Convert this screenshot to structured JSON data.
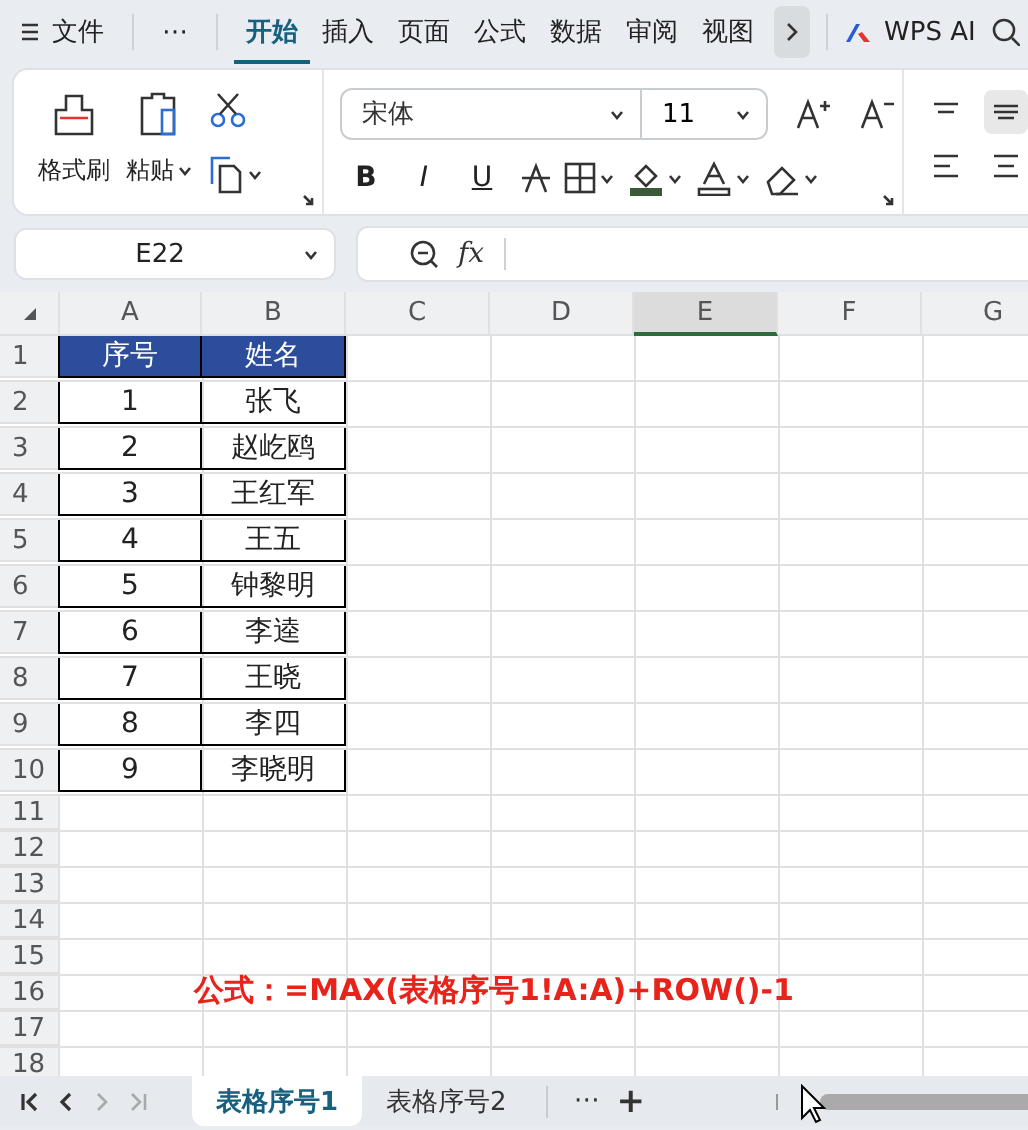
{
  "menu_bar": {
    "file": "文件",
    "more": "⋯",
    "tabs": [
      {
        "label": "开始",
        "selected": true
      },
      {
        "label": "插入",
        "selected": false
      },
      {
        "label": "页面",
        "selected": false
      },
      {
        "label": "公式",
        "selected": false
      },
      {
        "label": "数据",
        "selected": false
      },
      {
        "label": "审阅",
        "selected": false
      },
      {
        "label": "视图",
        "selected": false
      }
    ],
    "ai": "WPS AI"
  },
  "ribbon": {
    "format_painter": "格式刷",
    "paste": "粘贴",
    "font": "宋体",
    "font_size": "11",
    "format_buttons": [
      "B",
      "I",
      "U"
    ]
  },
  "formula_bar": {
    "name_box": "E22",
    "fx": "fx"
  },
  "columns": [
    {
      "label": "A",
      "selected": false
    },
    {
      "label": "B",
      "selected": false
    },
    {
      "label": "C",
      "selected": false
    },
    {
      "label": "D",
      "selected": false
    },
    {
      "label": "E",
      "selected": true
    },
    {
      "label": "F",
      "selected": false
    },
    {
      "label": "G",
      "selected": false
    }
  ],
  "rows": [
    {
      "number": "1",
      "kind": "header",
      "cells": [
        "序号",
        "姓名"
      ]
    },
    {
      "number": "2",
      "kind": "data",
      "cells": [
        "1",
        "张飞"
      ]
    },
    {
      "number": "3",
      "kind": "data",
      "cells": [
        "2",
        "赵屹鸥"
      ]
    },
    {
      "number": "4",
      "kind": "data",
      "cells": [
        "3",
        "王红军"
      ]
    },
    {
      "number": "5",
      "kind": "data",
      "cells": [
        "4",
        "王五"
      ]
    },
    {
      "number": "6",
      "kind": "data",
      "cells": [
        "5",
        "钟黎明"
      ]
    },
    {
      "number": "7",
      "kind": "data",
      "cells": [
        "6",
        "李逵"
      ]
    },
    {
      "number": "8",
      "kind": "data",
      "cells": [
        "7",
        "王晓"
      ]
    },
    {
      "number": "9",
      "kind": "data",
      "cells": [
        "8",
        "李四"
      ]
    },
    {
      "number": "10",
      "kind": "data",
      "cells": [
        "9",
        "李晓明"
      ]
    },
    {
      "number": "11",
      "kind": "empty"
    },
    {
      "number": "12",
      "kind": "empty"
    },
    {
      "number": "13",
      "kind": "empty"
    },
    {
      "number": "14",
      "kind": "empty"
    },
    {
      "number": "15",
      "kind": "empty"
    },
    {
      "number": "16",
      "kind": "empty",
      "note": "公式：=MAX(表格序号1!A:A)+ROW()-1"
    },
    {
      "number": "17",
      "kind": "empty"
    },
    {
      "number": "18",
      "kind": "empty"
    }
  ],
  "sheet_bar": {
    "tabs": [
      {
        "label": "表格序号1",
        "selected": true
      },
      {
        "label": "表格序号2",
        "selected": false
      }
    ],
    "more": "⋯",
    "add": "+"
  }
}
